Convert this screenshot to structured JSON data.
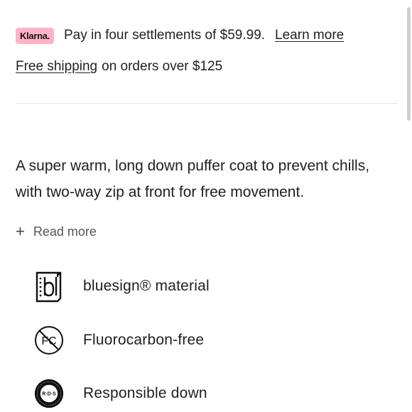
{
  "klarna": {
    "badge": "Klarna.",
    "text": "Pay in four settlements of $59.99.",
    "learn_more": "Learn more"
  },
  "shipping": {
    "link": "Free shipping",
    "text": "on orders over $125"
  },
  "description": "A super warm, long down puffer coat to prevent chills, with two-way zip at front for free movement.",
  "read_more": {
    "icon": "plus-icon",
    "label": "Read more"
  },
  "features": [
    {
      "icon": "bluesign-icon",
      "label": "bluesign® material"
    },
    {
      "icon": "fluorocarbon-free-icon",
      "label": "Fluorocarbon-free"
    },
    {
      "icon": "responsible-down-icon",
      "label": "Responsible down",
      "icon_text": "R·D·S"
    }
  ],
  "colors": {
    "klarna_pink": "#ffb3c7",
    "text": "#1f1f1f",
    "divider": "#e6e6e6"
  }
}
